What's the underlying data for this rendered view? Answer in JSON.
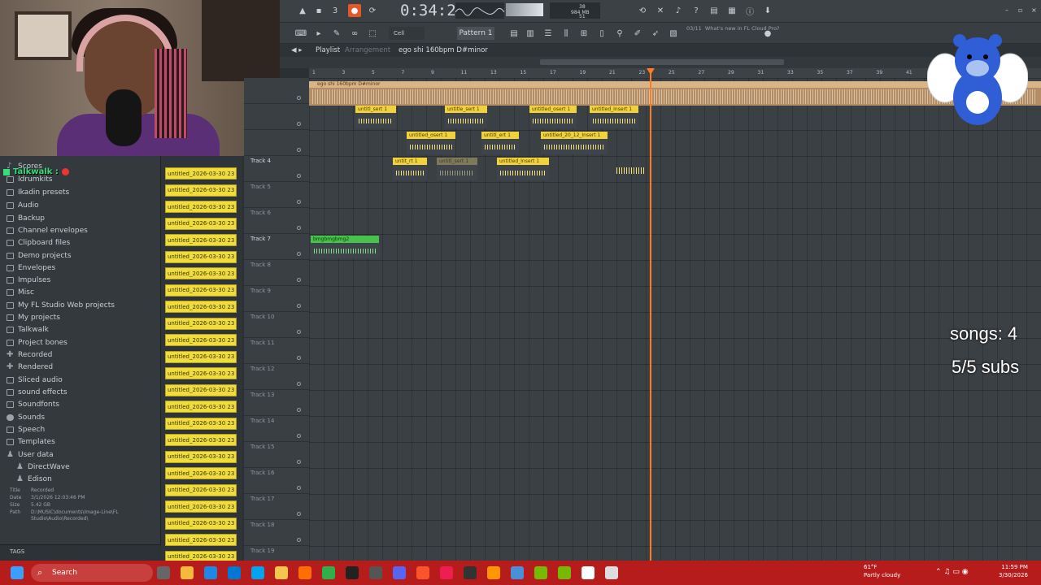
{
  "toolbar": {
    "time": "0:34:27",
    "snap": "Cell",
    "pattern": "Pattern 1",
    "cpu_top": "38",
    "cpu_mem": "984 MB",
    "cpu_val": "51",
    "news_date": "03/11",
    "news_title": "What's new in FL Cloud Pro?"
  },
  "playlist": {
    "title": "Playlist",
    "subtitle": "Arrangement",
    "arrangement": "ego shi 160bpm D#minor"
  },
  "ruler_ticks": [
    "1",
    "3",
    "5",
    "7",
    "9",
    "11",
    "13",
    "15",
    "17",
    "19",
    "21",
    "23",
    "25",
    "27",
    "29",
    "31",
    "33",
    "35",
    "37",
    "39",
    "41"
  ],
  "browser": {
    "items": [
      {
        "label": "Scores",
        "icon": "note-icon"
      },
      {
        "label": "Idrumkits",
        "icon": "folder-icon"
      },
      {
        "label": "Ikadin presets",
        "icon": "folder-icon"
      },
      {
        "label": "Audio",
        "icon": "folder-icon"
      },
      {
        "label": "Backup",
        "icon": "folder-icon"
      },
      {
        "label": "Channel envelopes",
        "icon": "folder-icon"
      },
      {
        "label": "Clipboard files",
        "icon": "folder-icon"
      },
      {
        "label": "Demo projects",
        "icon": "folder-icon"
      },
      {
        "label": "Envelopes",
        "icon": "folder-icon"
      },
      {
        "label": "Impulses",
        "icon": "folder-icon"
      },
      {
        "label": "Misc",
        "icon": "folder-icon"
      },
      {
        "label": "My FL Studio Web projects",
        "icon": "folder-icon"
      },
      {
        "label": "My projects",
        "icon": "folder-icon"
      },
      {
        "label": "Talkwalk",
        "icon": "folder-icon"
      },
      {
        "label": "Project bones",
        "icon": "folder-icon"
      },
      {
        "label": "Recorded",
        "icon": "plus-icon"
      },
      {
        "label": "Rendered",
        "icon": "plus-icon"
      },
      {
        "label": "Sliced audio",
        "icon": "folder-icon"
      },
      {
        "label": "sound effects",
        "icon": "folder-icon"
      },
      {
        "label": "Soundfonts",
        "icon": "folder-icon"
      },
      {
        "label": "Sounds",
        "icon": "cloud-icon"
      },
      {
        "label": "Speech",
        "icon": "folder-icon"
      },
      {
        "label": "Templates",
        "icon": "folder-icon"
      },
      {
        "label": "User data",
        "icon": "person-icon"
      },
      {
        "label": "DirectWave",
        "icon": "person-icon"
      },
      {
        "label": "Edison",
        "icon": "person-icon"
      }
    ],
    "info": {
      "title_k": "Title",
      "title_v": "Recorded",
      "date_k": "Date",
      "date_v": "3/1/2026 12:03:46 PM",
      "size_k": "Size",
      "size_v": "5.42 GB",
      "path_k": "Path",
      "path_v": "D:\\MUSIC\\documents\\Image-Line\\FL Studio\\Audio\\Recorded\\"
    },
    "tags_label": "TAGS"
  },
  "files": [
    "untitled_2026-03-30 23",
    "untitled_2026-03-30 23",
    "untitled_2026-03-30 23",
    "untitled_2026-03-30 23",
    "untitled_2026-03-30 23",
    "untitled_2026-03-30 23",
    "untitled_2026-03-30 23",
    "untitled_2026-03-30 23",
    "untitled_2026-03-30 23",
    "untitled_2026-03-30 23",
    "untitled_2026-03-30 23",
    "untitled_2026-03-30 23",
    "untitled_2026-03-30 23",
    "untitled_2026-03-30 23",
    "untitled_2026-03-30 23",
    "untitled_2026-03-30 23",
    "untitled_2026-03-30 23",
    "untitled_2026-03-30 23",
    "untitled_2026-03-30 23",
    "untitled_2026-03-30 23",
    "untitled_2026-03-30 23",
    "untitled_2026-03-30 23",
    "untitled_2026-03-30 23",
    "untitled_2026-03-30 23",
    "untitled_2026-03-30 23"
  ],
  "tracks": [
    "Track 4",
    "Track 5",
    "Track 6",
    "Track 7",
    "Track 8",
    "Track 9",
    "Track 10",
    "Track 11",
    "Track 12",
    "Track 13",
    "Track 14",
    "Track 15",
    "Track 16",
    "Track 17",
    "Track 18",
    "Track 19"
  ],
  "audio_track_label": "ego shi 160bpm D#minor",
  "clips": [
    {
      "label": "untitl_sert 1"
    },
    {
      "label": "untitle_sert 1"
    },
    {
      "label": "untitled_osert 1"
    },
    {
      "label": "untitled_Insert 1"
    },
    {
      "label": "untitled_osert 1"
    },
    {
      "label": "untitl_ert 1"
    },
    {
      "label": "untitled_20_12_Insert 1"
    },
    {
      "label": "untit_rt 1"
    },
    {
      "label": "untitl_sert 1"
    },
    {
      "label": "untitled_Insert 1"
    },
    {
      "label": "bmgbmgbmg2"
    }
  ],
  "overlay": {
    "songs": "songs: 4",
    "subs": "5/5 subs",
    "talkwalk": "Talkwalk :"
  },
  "taskbar": {
    "search": "Search",
    "temp": "61°F",
    "weather": "Partly cloudy",
    "time": "11:59 PM",
    "date": "3/30/2026"
  },
  "colors": {
    "clip_yellow": "#f1d23b",
    "clip_green": "#47c24a",
    "playhead": "#ff7a20",
    "taskbar": "#b71c1c"
  }
}
